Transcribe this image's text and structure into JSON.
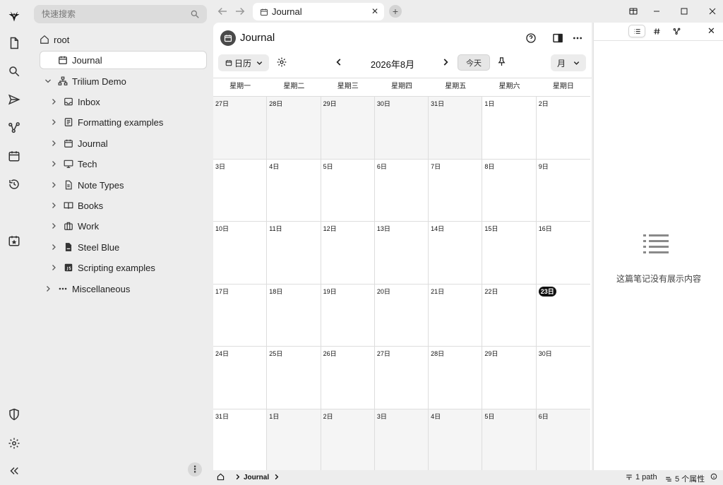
{
  "search": {
    "placeholder": "快速搜索"
  },
  "launcher": {
    "items": [
      "logo",
      "new-note",
      "search",
      "send",
      "graph",
      "calendar",
      "history",
      "today",
      "protected",
      "settings",
      "collapse"
    ]
  },
  "tree": {
    "root_label": "root",
    "nodes": [
      {
        "label": "Journal",
        "icon": "calendar-icon",
        "selected": true
      },
      {
        "label": "Trilium Demo",
        "icon": "sitemap-icon"
      },
      {
        "label": "Inbox",
        "icon": "inbox-icon"
      },
      {
        "label": "Formatting examples",
        "icon": "document-icon"
      },
      {
        "label": "Journal",
        "icon": "calendar-icon"
      },
      {
        "label": "Tech",
        "icon": "monitor-icon"
      },
      {
        "label": "Note Types",
        "icon": "file-icon"
      },
      {
        "label": "Books",
        "icon": "book-icon"
      },
      {
        "label": "Work",
        "icon": "briefcase-icon"
      },
      {
        "label": "Steel Blue",
        "icon": "code-file-icon"
      },
      {
        "label": "Scripting examples",
        "icon": "js-file-icon"
      },
      {
        "label": "Miscellaneous",
        "icon": "dots-icon"
      }
    ],
    "menu_label": "⋮"
  },
  "tabs": [
    {
      "label": "Journal",
      "icon": "calendar-icon",
      "active": true
    }
  ],
  "note": {
    "title": "Journal",
    "view_label": "日历",
    "month_label": "2026年8月",
    "today_label": "今天",
    "range_label": "月"
  },
  "calendar": {
    "weekdays": [
      "星期一",
      "星期二",
      "星期三",
      "星期四",
      "星期五",
      "星期六",
      "星期日"
    ],
    "weeks": [
      [
        {
          "d": "27日",
          "other": true
        },
        {
          "d": "28日",
          "other": true
        },
        {
          "d": "29日",
          "other": true
        },
        {
          "d": "30日",
          "other": true
        },
        {
          "d": "31日",
          "other": true
        },
        {
          "d": "1日"
        },
        {
          "d": "2日"
        }
      ],
      [
        {
          "d": "3日"
        },
        {
          "d": "4日"
        },
        {
          "d": "5日"
        },
        {
          "d": "6日"
        },
        {
          "d": "7日"
        },
        {
          "d": "8日"
        },
        {
          "d": "9日"
        }
      ],
      [
        {
          "d": "10日"
        },
        {
          "d": "11日"
        },
        {
          "d": "12日"
        },
        {
          "d": "13日"
        },
        {
          "d": "14日"
        },
        {
          "d": "15日"
        },
        {
          "d": "16日"
        }
      ],
      [
        {
          "d": "17日"
        },
        {
          "d": "18日"
        },
        {
          "d": "19日"
        },
        {
          "d": "20日"
        },
        {
          "d": "21日"
        },
        {
          "d": "22日"
        },
        {
          "d": "23日",
          "today": true
        }
      ],
      [
        {
          "d": "24日"
        },
        {
          "d": "25日"
        },
        {
          "d": "26日"
        },
        {
          "d": "27日"
        },
        {
          "d": "28日"
        },
        {
          "d": "29日"
        },
        {
          "d": "30日"
        }
      ],
      [
        {
          "d": "31日"
        },
        {
          "d": "1日",
          "other": true
        },
        {
          "d": "2日",
          "other": true
        },
        {
          "d": "3日",
          "other": true
        },
        {
          "d": "4日",
          "other": true
        },
        {
          "d": "5日",
          "other": true
        },
        {
          "d": "6日",
          "other": true
        }
      ]
    ]
  },
  "right_panel": {
    "tabs": [
      "toc-icon",
      "hashtag-icon",
      "graph-icon"
    ],
    "empty_text": "这篇笔记没有展示内容"
  },
  "statusbar": {
    "breadcrumb": "Journal",
    "path_label": "1 path",
    "attributes_label": "5 个属性"
  },
  "colors": {
    "accent_today": "#111111",
    "background": "#ededed"
  }
}
